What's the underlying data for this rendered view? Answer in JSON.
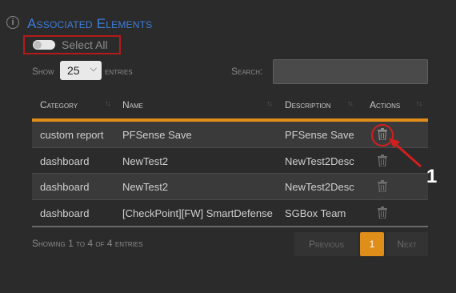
{
  "section": {
    "title": "Associated Elements"
  },
  "select_all": {
    "label": "Select All"
  },
  "controls": {
    "show_label": "Show",
    "entries_value": "25",
    "entries_label": "entries",
    "search_label": "Search:",
    "search_value": ""
  },
  "table": {
    "columns": [
      "Category",
      "Name",
      "Description",
      "Actions"
    ],
    "rows": [
      {
        "category": "custom report",
        "name": "PFSense Save",
        "description": "PFSense Save"
      },
      {
        "category": "dashboard",
        "name": "NewTest2",
        "description": "NewTest2Desc"
      },
      {
        "category": "dashboard",
        "name": "NewTest2",
        "description": "NewTest2Desc"
      },
      {
        "category": "dashboard",
        "name": "[CheckPoint][FW] SmartDefense",
        "description": "SGBox Team"
      }
    ]
  },
  "footer": {
    "info": "Showing 1 to 4 of 4 entries",
    "previous": "Previous",
    "page": "1",
    "next": "Next"
  },
  "annotation": {
    "number": "1",
    "color": "#d11f1f"
  },
  "colors": {
    "accent": "#e08e1a",
    "title": "#3d7dd8",
    "highlight": "#b31b1b"
  },
  "icons": {
    "info": "info-circle-icon",
    "trash": "trash-icon",
    "chevron": "chevron-down-icon"
  }
}
